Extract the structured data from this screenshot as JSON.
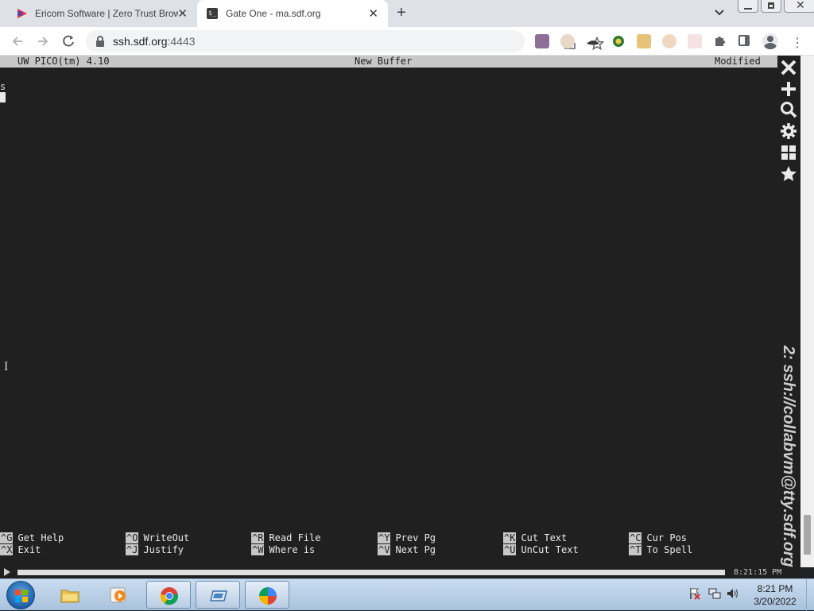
{
  "browser": {
    "tabs": [
      {
        "title": "Ericom Software | Zero Trust Brow",
        "favicon": "ericom-icon",
        "active": false
      },
      {
        "title": "Gate One - ma.sdf.org",
        "favicon": "terminal-icon",
        "active": true
      }
    ],
    "url_host": "ssh.sdf.org",
    "url_port": ":4443"
  },
  "terminal": {
    "header": {
      "app": "UW PICO(tm) 4.10",
      "buffer": "New Buffer",
      "status": "Modified"
    },
    "lines": [
      "s"
    ],
    "shortcuts": [
      [
        {
          "key": "^G",
          "label": "Get Help"
        },
        {
          "key": "^X",
          "label": "Exit"
        }
      ],
      [
        {
          "key": "^O",
          "label": "WriteOut"
        },
        {
          "key": "^J",
          "label": "Justify"
        }
      ],
      [
        {
          "key": "^R",
          "label": "Read File"
        },
        {
          "key": "^W",
          "label": "Where is"
        }
      ],
      [
        {
          "key": "^Y",
          "label": "Prev Pg"
        },
        {
          "key": "^V",
          "label": "Next Pg"
        }
      ],
      [
        {
          "key": "^K",
          "label": "Cut Text"
        },
        {
          "key": "^U",
          "label": "UnCut Text"
        }
      ],
      [
        {
          "key": "^C",
          "label": "Cur Pos"
        },
        {
          "key": "^T",
          "label": "To Spell"
        }
      ]
    ],
    "session_title": "2: ssh://collabvm@tty.sdf.org",
    "playback_time": "8:21:15 PM",
    "playback_progress": 1.0
  },
  "gateone_toolbar": [
    "close-icon",
    "new-terminal-icon",
    "search-icon",
    "settings-icon",
    "grid-icon",
    "bookmarks-icon"
  ],
  "taskbar": {
    "clock_time": "8:21 PM",
    "clock_date": "3/20/2022"
  },
  "colors": {
    "terminal_bg": "#202020",
    "header_bg": "#c7c7c7",
    "tabstrip_bg": "#dee1e6"
  }
}
